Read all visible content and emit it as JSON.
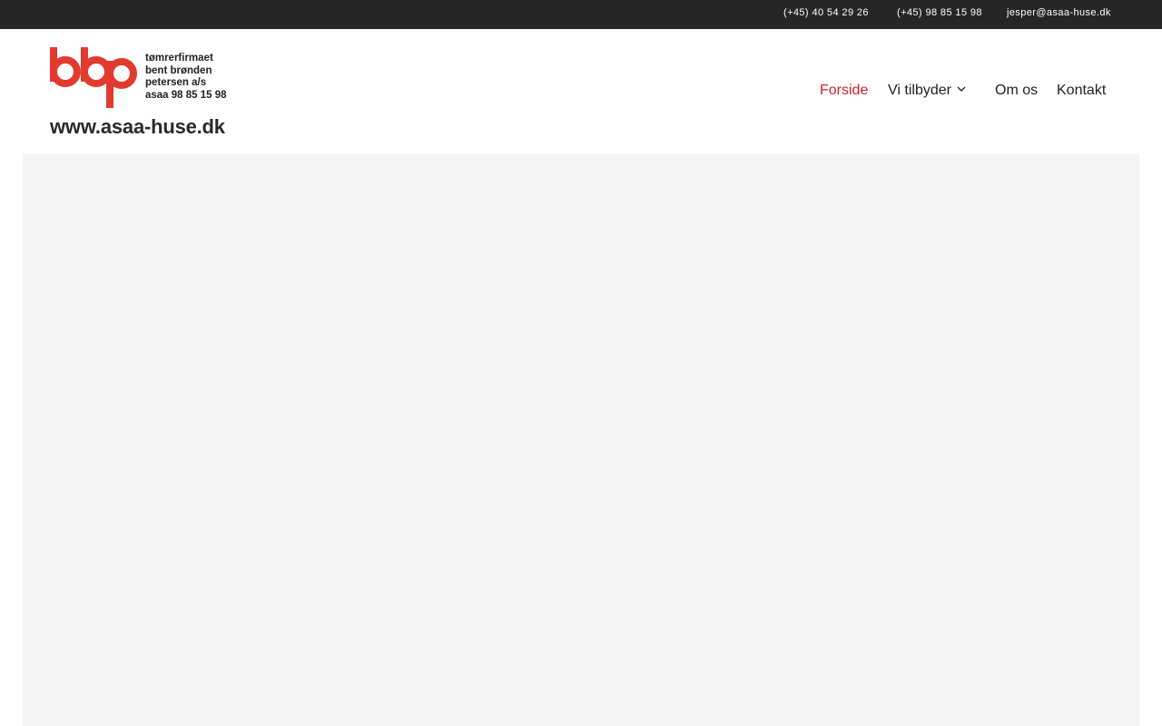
{
  "topbar": {
    "phone1": "(+45) 40 54 29 26",
    "phone2": "(+45) 98 85 15 98",
    "email": "jesper@asaa-huse.dk"
  },
  "logo": {
    "lines": [
      "tømrerfirmaet",
      "bent brønden",
      "petersen a/s",
      "asaa 98 85 15 98"
    ],
    "url": "www.asaa-huse.dk",
    "brand_color": "#e23a2e"
  },
  "nav": {
    "items": [
      {
        "label": "Forside",
        "active": true
      },
      {
        "label": "Vi tilbyder",
        "has_dropdown": true,
        "icon": "chevron-down-icon"
      },
      {
        "label": "Om os"
      },
      {
        "label": "Kontakt"
      }
    ],
    "active_color": "#d61f26"
  },
  "colors": {
    "topbar_bg": "#262626",
    "hero_bg": "#f5f5f5"
  }
}
